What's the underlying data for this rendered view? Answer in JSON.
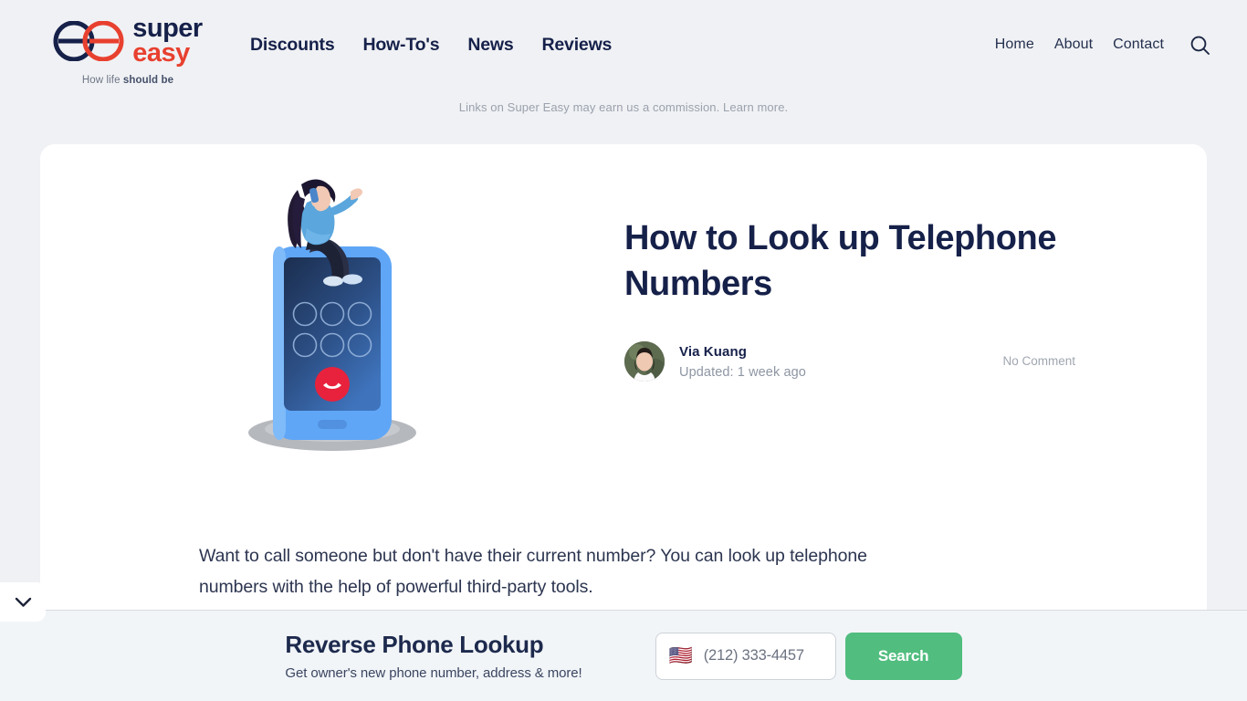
{
  "header": {
    "brand": {
      "name_part1": "super",
      "name_part2": "easy",
      "tagline_prefix": "How life ",
      "tagline_bold": "should be",
      "logo_navy": "#16214a",
      "logo_red": "#e8402f"
    },
    "main_nav": [
      {
        "label": "Discounts"
      },
      {
        "label": "How-To's"
      },
      {
        "label": "News"
      },
      {
        "label": "Reviews"
      }
    ],
    "util_nav": [
      {
        "label": "Home"
      },
      {
        "label": "About"
      },
      {
        "label": "Contact"
      }
    ],
    "search_icon": "search-icon"
  },
  "disclaimer": {
    "text": "Links on Super Easy may earn us a commission.",
    "link_label": "Learn more."
  },
  "article": {
    "title": "How to Look up Telephone Numbers",
    "author": "Via Kuang",
    "updated": "Updated: 1 week ago",
    "comments": "No Comment",
    "body_paragraph": "Want to call someone but don't have their current number? You can look up telephone numbers with the help of powerful third-party tools.",
    "illustration_name": "woman-sitting-on-phone-illustration"
  },
  "collapse_tab": {
    "icon": "chevron-down-icon"
  },
  "lookup_bar": {
    "title": "Reverse Phone Lookup",
    "subtitle": "Get owner's new phone number, address & more!",
    "country_flag": "🇺🇸",
    "phone_placeholder": "(212) 333-4457",
    "phone_value": "",
    "search_label": "Search",
    "accent_green": "#51bd7f"
  }
}
